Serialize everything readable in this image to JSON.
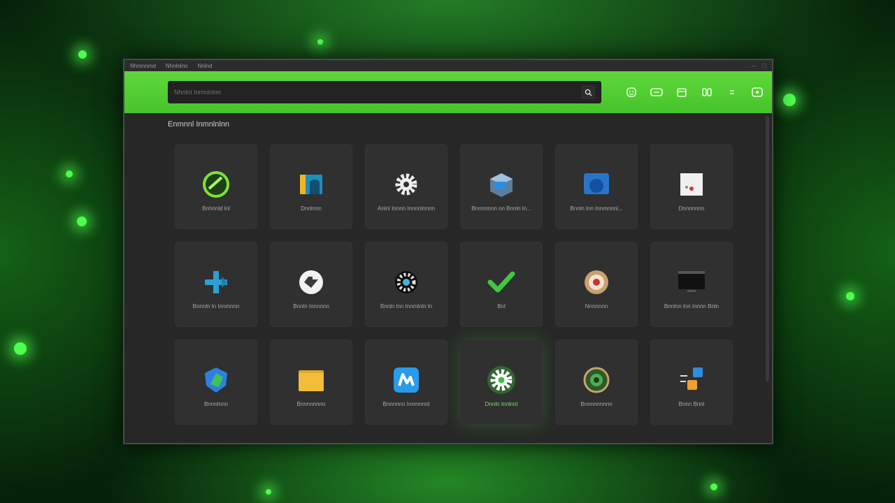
{
  "window": {
    "menu": [
      "Nhnmnmd",
      "Nhnlnlnn",
      "Nnlnd"
    ]
  },
  "search": {
    "placeholder": "Nhnlnl Inmnlnlnn",
    "button_icon": "search-icon"
  },
  "toolbar_icons": [
    "emoji-icon",
    "chat-icon",
    "calendar-icon",
    "apps-icon",
    "hash-icon",
    "settings-icon"
  ],
  "section": {
    "title": "Enmnnl Inmnlnlnn"
  },
  "apps": [
    {
      "label": "Bnhnnld lnl",
      "icon": "green-circle-icon"
    },
    {
      "label": "Dnnlnnn",
      "icon": "folder-book-icon"
    },
    {
      "label": "Anlnl Innnn Innnnlnnnn",
      "icon": "gear-icon"
    },
    {
      "label": "Bnnnnnnn nn Bnnln ln...",
      "icon": "cube-icon"
    },
    {
      "label": "Bnnln lnn Innmnnnl...",
      "icon": "blue-box-icon"
    },
    {
      "label": "Dnnnnnnn",
      "icon": "document-icon"
    },
    {
      "label": "Bnnnln ln Innmnnn",
      "icon": "plus-icon"
    },
    {
      "label": "Bnnln Innnnnn",
      "icon": "download-icon"
    },
    {
      "label": "Bnnln lnn Innmlnln ln",
      "icon": "cog-icon"
    },
    {
      "label": "Bnl",
      "icon": "checkmark-icon"
    },
    {
      "label": "Nnnnnnn",
      "icon": "target-icon"
    },
    {
      "label": "Bnnlnn lnn Innnn Bnln",
      "icon": "monitor-icon"
    },
    {
      "label": "Bnnnlnnn",
      "icon": "shield-icon"
    },
    {
      "label": "Bnnnnnnnn",
      "icon": "folder-icon"
    },
    {
      "label": "Bnnnnnn Innmnnnl",
      "icon": "photo-app-icon"
    },
    {
      "label": "Dnnln Innlnnl",
      "icon": "settings-gear-icon"
    },
    {
      "label": "Bnnnnnnnnn",
      "icon": "globe-icon"
    },
    {
      "label": "Bnnn Bnnl",
      "icon": "network-icon"
    }
  ],
  "colors": {
    "accent": "#4ac72c",
    "window_bg": "#272727",
    "tile_bg": "#303030"
  }
}
